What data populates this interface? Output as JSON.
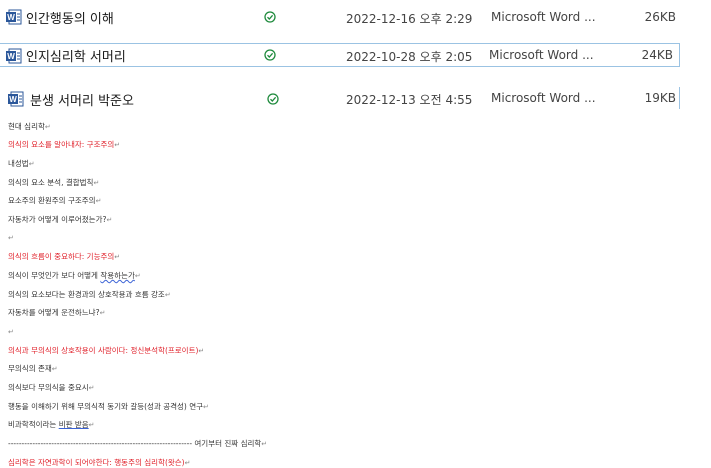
{
  "files": [
    {
      "name": "인간행동의 이해",
      "date": "2022-12-16 오후 2:29",
      "type": "Microsoft Word ...",
      "size": "26KB",
      "status_icon": "synced-check-icon",
      "file_icon": "word-doc-icon"
    },
    {
      "name": "인지심리학 서머리",
      "date": "2022-10-28 오후 2:05",
      "type": "Microsoft Word ...",
      "size": "24KB",
      "status_icon": "synced-check-icon",
      "file_icon": "word-doc-icon"
    },
    {
      "name": "분생 서머리 박준오",
      "date": "2022-12-13 오전 4:55",
      "type": "Microsoft Word ...",
      "size": "19KB",
      "status_icon": "synced-check-icon",
      "file_icon": "word-doc-icon"
    }
  ],
  "document": {
    "lines": [
      {
        "text": "현대 심리학",
        "color": "normal"
      },
      {
        "text": "의식의 요소를 알아내자: 구조주의",
        "color": "red"
      },
      {
        "text": "내성법",
        "color": "normal"
      },
      {
        "text": "의식의 요소 분석, 결합법칙",
        "color": "normal"
      },
      {
        "text": "요소주의 환원주의 구조주의",
        "color": "normal"
      },
      {
        "text": "자동차가 어떻게 이루어졌는가?",
        "color": "normal"
      },
      {
        "text": "",
        "color": "normal"
      },
      {
        "text": "의식의 흐름이 중요하다: 기능주의",
        "color": "red"
      },
      {
        "text_pre": "의식이 무엇인가 보다 어떻게 ",
        "text_marked": "작용하는가",
        "color": "normal"
      },
      {
        "text": "의식의 요소보다는 환경과의 상호작용과 흐름 강조",
        "color": "normal"
      },
      {
        "text": "자동차를 어떻게 운전하느냐?",
        "color": "normal"
      },
      {
        "text": "",
        "color": "normal"
      },
      {
        "text": "의식과 무의식의 상호작용이 사람이다: 정신분석학(프로이트)",
        "color": "red"
      },
      {
        "text": "무의식의 존재",
        "color": "normal"
      },
      {
        "text": "의식보다 무의식을 중요시",
        "color": "normal"
      },
      {
        "text": "행동을 이해하기 위해 무의식적 동기와 갈등(성과 공격성) 연구",
        "color": "normal"
      },
      {
        "text_pre": "비과학적이라는 ",
        "text_marked": "비판 받음",
        "color": "normal"
      },
      {
        "text": "-------------------------------------------------------------------- 여기부터 진짜 심리학",
        "color": "normal"
      },
      {
        "text": "심리학은 자연과학이 되어야한다: 행동주의 심리학(왓슨)",
        "color": "red"
      }
    ],
    "paragraph_mark": "↵",
    "colors": {
      "red": "#e0202a",
      "normal": "#333333",
      "spell_mark": "#3b63d6"
    }
  },
  "colors": {
    "selection_border": "#9bc3e3",
    "check_green": "#1e8a3c",
    "word_blue": "#2b579a"
  }
}
